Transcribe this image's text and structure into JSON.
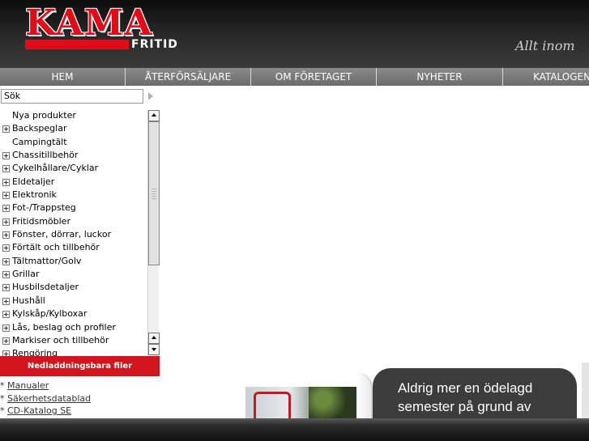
{
  "header": {
    "logo_main": "KAMA",
    "logo_sub": "FRITID",
    "tagline": "Allt inom",
    "brand_red": "#e30b17"
  },
  "nav": {
    "items": [
      "HEM",
      "ÅTERFÖRSÄLJARE",
      "OM FÖRETAGET",
      "NYHETER",
      "KATALOGEN"
    ]
  },
  "sidebar": {
    "search_value": "Sök",
    "categories": [
      {
        "label": "Nya produkter",
        "expandable": false
      },
      {
        "label": "Backspeglar",
        "expandable": true
      },
      {
        "label": "Campingtält",
        "expandable": false
      },
      {
        "label": "Chassitillbehör",
        "expandable": true
      },
      {
        "label": "Cykelhållare/Cyklar",
        "expandable": true
      },
      {
        "label": "Eldetaljer",
        "expandable": true
      },
      {
        "label": "Elektronik",
        "expandable": true
      },
      {
        "label": "Fot-/Trappsteg",
        "expandable": true
      },
      {
        "label": "Fritidsmöbler",
        "expandable": true
      },
      {
        "label": "Fönster, dörrar, luckor",
        "expandable": true
      },
      {
        "label": "Förtält och tillbehör",
        "expandable": true
      },
      {
        "label": "Tältmattor/Golv",
        "expandable": true
      },
      {
        "label": "Grillar",
        "expandable": true
      },
      {
        "label": "Husbilsdetaljer",
        "expandable": true
      },
      {
        "label": "Hushåll",
        "expandable": true
      },
      {
        "label": "Kylskåp/Kylboxar",
        "expandable": true
      },
      {
        "label": "Lås, beslag och profiler",
        "expandable": true
      },
      {
        "label": "Markiser och tillbehör",
        "expandable": true
      },
      {
        "label": "Rengöring",
        "expandable": true
      }
    ],
    "downloads_title": "Nedladdningsbara filer",
    "downloads": [
      "Manualer",
      "Säkerhetsdatablad",
      "CD-Katalog SE"
    ]
  },
  "ad": {
    "line1": "Aldrig mer en ödelagd",
    "line2": "semester på grund av"
  }
}
